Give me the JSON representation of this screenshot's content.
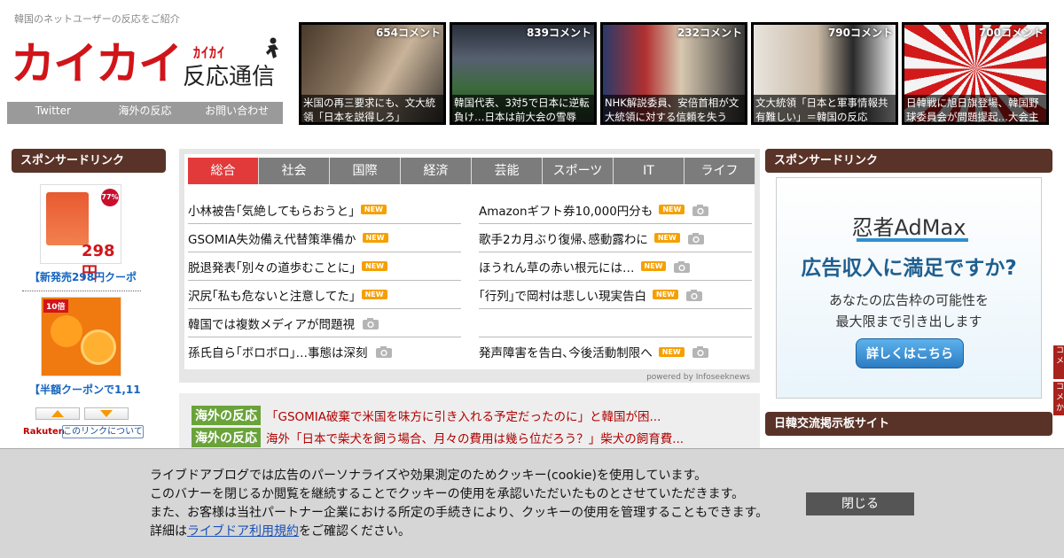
{
  "header": {
    "tagline": "韓国のネットユーザーの反応をご紹介",
    "logo_main": "カイカイ",
    "logo_kana": "ｶｲｶｲ",
    "logo_sub": "反応通信",
    "nav": [
      "Twitter",
      "海外の反応",
      "お問い合わせ"
    ]
  },
  "thumbs": [
    {
      "comments": "654コメント",
      "caption": "米国の再三要求にも、文大統領「日本を説得しろ」"
    },
    {
      "comments": "839コメント",
      "caption": "韓国代表、3対5で日本に逆転負け…日本は前大会の雪辱"
    },
    {
      "comments": "232コメント",
      "caption": "NHK解説委員、安倍首相が文大統領に対する信頼を失う"
    },
    {
      "comments": "790コメント",
      "caption": "文大統領「日本と軍事情報共有難しい」＝韓国の反応"
    },
    {
      "comments": "700コメント",
      "caption": "日韓戦に旭日旗登場、韓国野球委員会が問題提起…大会主"
    }
  ],
  "left_sidebar": {
    "heading": "スポンサードリンク",
    "ad1_label": "【新発売298円クーポ",
    "ad1_price": "298円",
    "ad1_badge": "77%",
    "ad2_label": "【半額クーポンで1,11",
    "ad2_badge": "10倍",
    "rakuten": "Rakuten",
    "about_link": "このリンクについて"
  },
  "news": {
    "tabs": [
      "総合",
      "社会",
      "国際",
      "経済",
      "芸能",
      "スポーツ",
      "IT",
      "ライフ"
    ],
    "new_label": "NEW",
    "left": [
      {
        "title": "小林被告｢気絶してもらおうと｣",
        "new": true,
        "photo": false
      },
      {
        "title": "GSOMIA失効備え代替策準備か",
        "new": true,
        "photo": false
      },
      {
        "title": "脱退発表｢別々の道歩むことに｣",
        "new": true,
        "photo": false
      },
      {
        "title": "沢尻｢私も危ないと注意してた｣",
        "new": true,
        "photo": false
      },
      {
        "title": "韓国では複数メディアが問題視",
        "new": false,
        "photo": true
      },
      {
        "title": "孫氏自ら｢ボロボロ｣…事態は深刻",
        "new": false,
        "photo": true
      }
    ],
    "right": [
      {
        "title": "Amazonギフト券10,000円分も",
        "new": true,
        "photo": true
      },
      {
        "title": "歌手2カ月ぶり復帰､感動露わに",
        "new": true,
        "photo": true
      },
      {
        "title": "ほうれん草の赤い根元には…",
        "new": true,
        "photo": true
      },
      {
        "title": "｢行列｣で岡村は悲しい現実告白",
        "new": true,
        "photo": true
      },
      {
        "title": "",
        "new": false,
        "photo": false
      },
      {
        "title": "発声障害を告白､今後活動制限へ",
        "new": true,
        "photo": true
      }
    ],
    "powered": "powered by Infoseeknews"
  },
  "overseas": {
    "tag": "海外の反応",
    "items": [
      "「GSOMIA破棄で米国を味方に引き入れる予定だったのに」と韓国が困...",
      "海外「日本で柴犬を飼う場合、月々の費用は幾ら位だろう？」柴犬の飼育費..."
    ]
  },
  "right_sidebar": {
    "heading": "スポンサードリンク",
    "admax_brand": "忍者AdMax",
    "admax_head": "広告収入に満足ですか?",
    "admax_sub1": "あなたの広告枠の可能性を",
    "admax_sub2": "最大限まで引き出します",
    "admax_btn": "詳しくはこちら",
    "heading2": "日韓交流掲示板サイト",
    "edge_tabs": [
      "コメ",
      "コメか"
    ]
  },
  "cookie": {
    "line1": "ライブドアブログでは広告のパーソナライズや効果測定のためクッキー(cookie)を使用しています。",
    "line2": "このバナーを閉じるか閲覧を継続することでクッキーの使用を承認いただいたものとさせていただきます。",
    "line3": "また、お客様は当社パートナー企業における所定の手続きにより、クッキーの使用を管理することもできます。",
    "line4_prefix": "詳細は",
    "line4_link": "ライブドア利用規約",
    "line4_suffix": "をご確認ください。",
    "close": "閉じる"
  },
  "colors": {
    "brand_red": "#d0151a",
    "side_header": "#5a3328",
    "tab_active": "#e23a3a",
    "overseas_tag": "#6aa33a"
  }
}
